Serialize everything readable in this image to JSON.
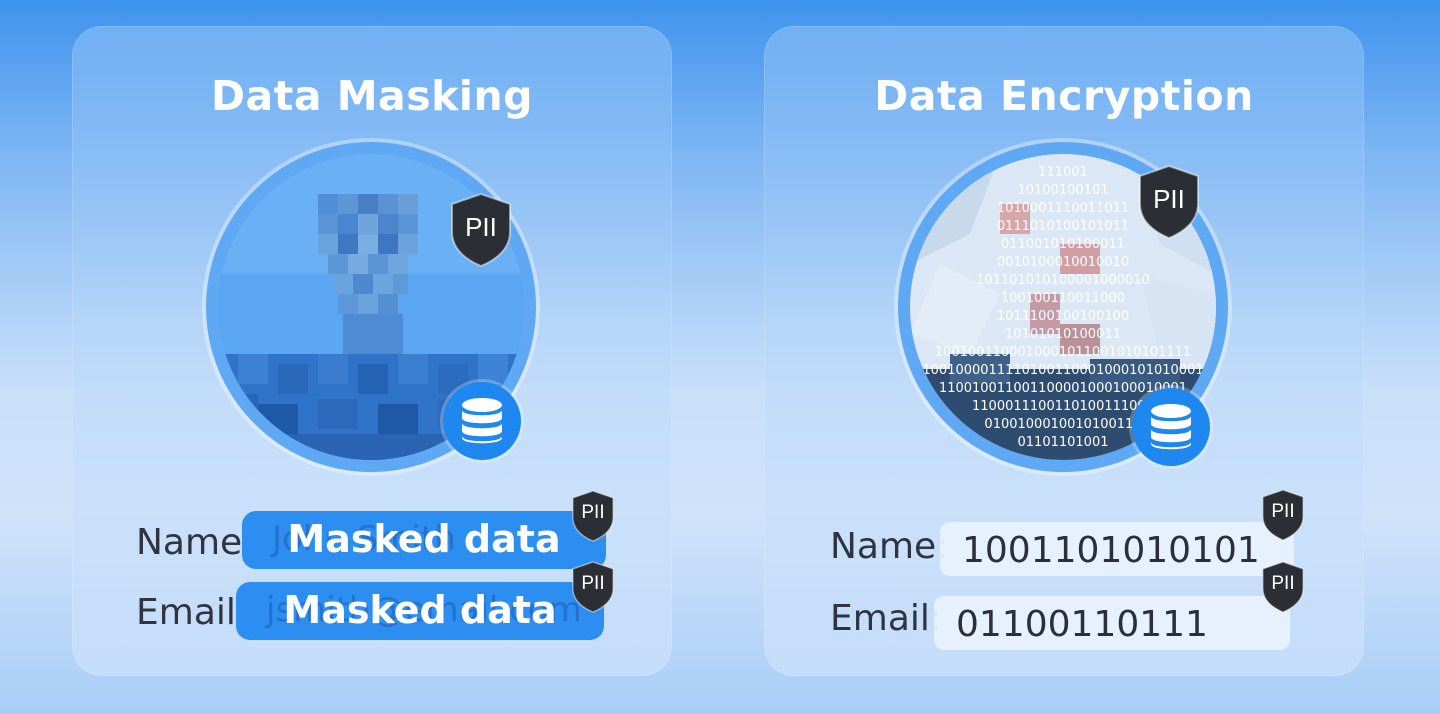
{
  "cards": {
    "masking": {
      "title": "Data Masking",
      "pii_badge": "PII",
      "name_label": "Name:",
      "email_label": "Email:",
      "name_under": "John Smith",
      "email_under": "jsmith@email.com",
      "name_masked": "Masked data",
      "email_masked": "Masked data",
      "icons": [
        "pii-shield-icon",
        "database-icon"
      ]
    },
    "encryption": {
      "title": "Data Encryption",
      "pii_badge": "PII",
      "name_label": "Name:",
      "email_label": "Email:",
      "name_value": "1001101010101",
      "email_value": "01100110111",
      "binary_lines": [
        "111001",
        "10100100101",
        "1010001110011011",
        "0111010100101011",
        "011001010100011",
        "0010100010010010",
        "101101010100001000010",
        "100100110011000",
        "1011100100100100",
        "10101010100011",
        "1001001100010001011001010101111",
        "1001000011110100110001000101010001",
        "110010011001100001000100010001",
        "1100011100110100111001",
        "0100100010010100111",
        "01101101001"
      ],
      "icons": [
        "pii-shield-icon",
        "database-icon"
      ]
    }
  },
  "colors": {
    "accent": "#2d8ef2",
    "shield": "#2b2f35",
    "db_badge": "#1e88f0"
  }
}
